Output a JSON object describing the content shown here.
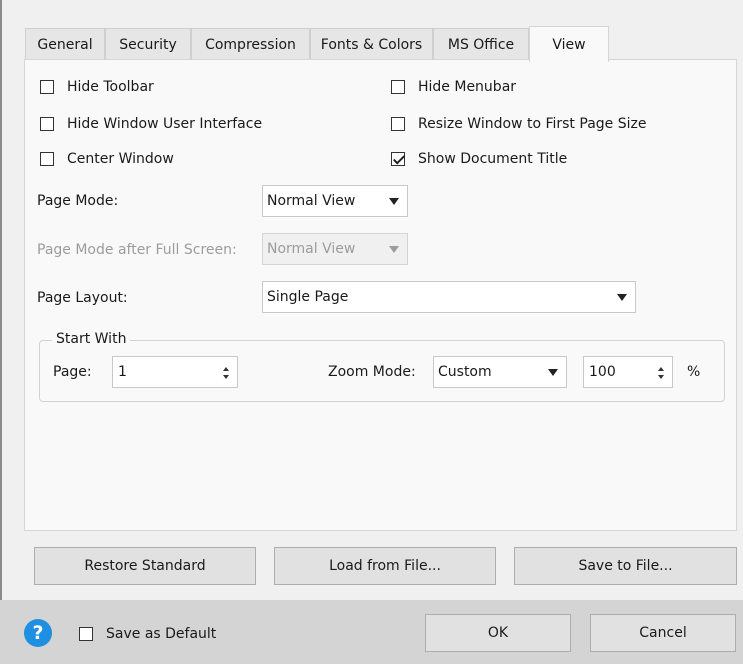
{
  "tabs": [
    {
      "label": "General"
    },
    {
      "label": "Security"
    },
    {
      "label": "Compression"
    },
    {
      "label": "Fonts & Colors"
    },
    {
      "label": "MS Office"
    },
    {
      "label": "View",
      "active": true
    }
  ],
  "options": {
    "hide_toolbar": {
      "label": "Hide Toolbar",
      "checked": false
    },
    "hide_menubar": {
      "label": "Hide Menubar",
      "checked": false
    },
    "hide_window_ui": {
      "label": "Hide Window User Interface",
      "checked": false
    },
    "resize_window": {
      "label": "Resize Window to First Page Size",
      "checked": false
    },
    "center_window": {
      "label": "Center Window",
      "checked": false
    },
    "show_doc_title": {
      "label": "Show Document Title",
      "checked": true
    }
  },
  "page_mode": {
    "label": "Page Mode:",
    "value": "Normal View"
  },
  "page_mode_fullscreen": {
    "label": "Page Mode after Full Screen:",
    "value": "Normal View",
    "disabled": true
  },
  "page_layout": {
    "label": "Page Layout:",
    "value": "Single Page"
  },
  "start_with": {
    "title": "Start With",
    "page_label": "Page:",
    "page_value": "1",
    "zoom_mode_label": "Zoom Mode:",
    "zoom_mode_value": "Custom",
    "zoom_value": "100",
    "zoom_unit": "%"
  },
  "actions": {
    "restore": "Restore Standard",
    "load": "Load from File...",
    "save": "Save to File..."
  },
  "footer": {
    "help_glyph": "?",
    "save_default_label": "Save as Default",
    "save_default_checked": false,
    "ok": "OK",
    "cancel": "Cancel",
    "help_color": "#1e8fe1"
  }
}
